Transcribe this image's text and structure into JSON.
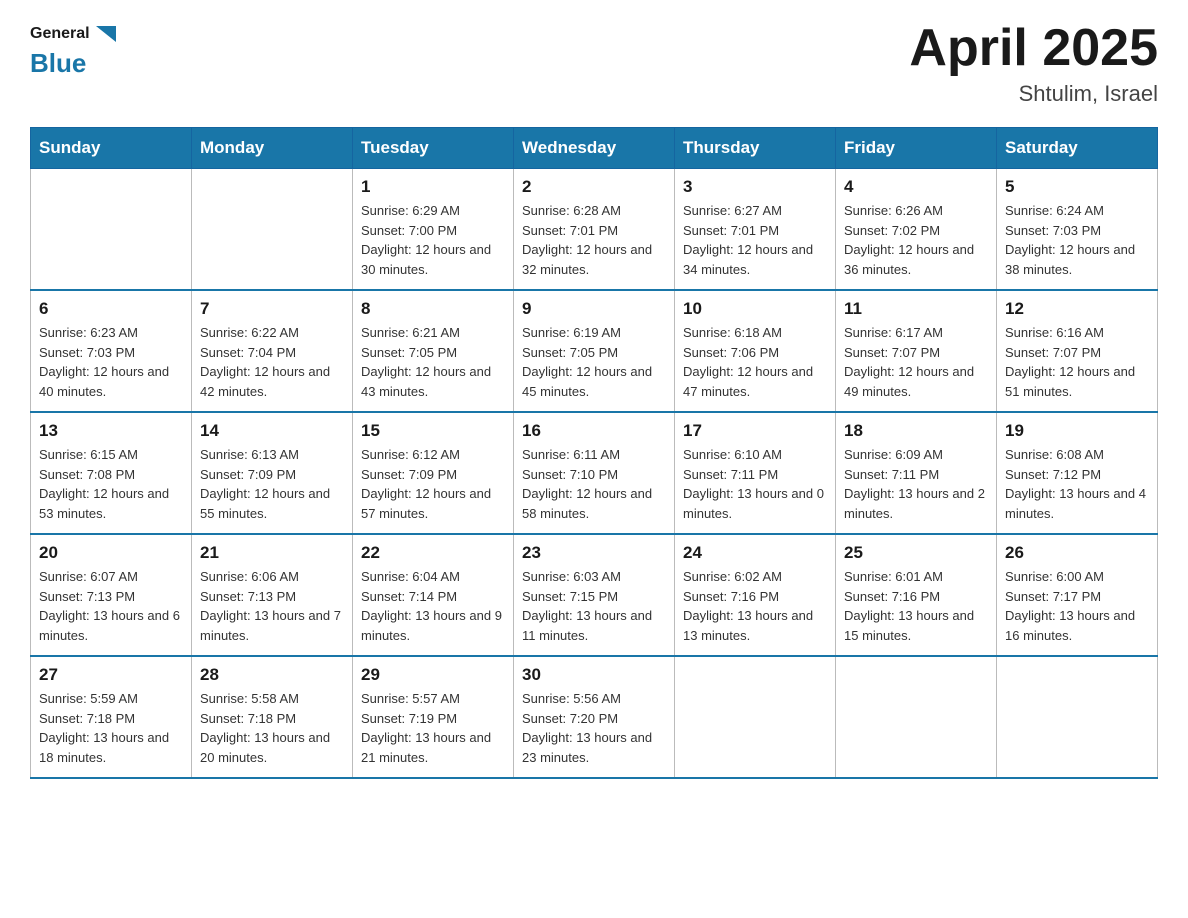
{
  "header": {
    "logo_general": "General",
    "logo_blue": "Blue",
    "month_title": "April 2025",
    "location": "Shtulim, Israel"
  },
  "days_of_week": [
    "Sunday",
    "Monday",
    "Tuesday",
    "Wednesday",
    "Thursday",
    "Friday",
    "Saturday"
  ],
  "weeks": [
    [
      {
        "day": "",
        "sunrise": "",
        "sunset": "",
        "daylight": ""
      },
      {
        "day": "",
        "sunrise": "",
        "sunset": "",
        "daylight": ""
      },
      {
        "day": "1",
        "sunrise": "Sunrise: 6:29 AM",
        "sunset": "Sunset: 7:00 PM",
        "daylight": "Daylight: 12 hours and 30 minutes."
      },
      {
        "day": "2",
        "sunrise": "Sunrise: 6:28 AM",
        "sunset": "Sunset: 7:01 PM",
        "daylight": "Daylight: 12 hours and 32 minutes."
      },
      {
        "day": "3",
        "sunrise": "Sunrise: 6:27 AM",
        "sunset": "Sunset: 7:01 PM",
        "daylight": "Daylight: 12 hours and 34 minutes."
      },
      {
        "day": "4",
        "sunrise": "Sunrise: 6:26 AM",
        "sunset": "Sunset: 7:02 PM",
        "daylight": "Daylight: 12 hours and 36 minutes."
      },
      {
        "day": "5",
        "sunrise": "Sunrise: 6:24 AM",
        "sunset": "Sunset: 7:03 PM",
        "daylight": "Daylight: 12 hours and 38 minutes."
      }
    ],
    [
      {
        "day": "6",
        "sunrise": "Sunrise: 6:23 AM",
        "sunset": "Sunset: 7:03 PM",
        "daylight": "Daylight: 12 hours and 40 minutes."
      },
      {
        "day": "7",
        "sunrise": "Sunrise: 6:22 AM",
        "sunset": "Sunset: 7:04 PM",
        "daylight": "Daylight: 12 hours and 42 minutes."
      },
      {
        "day": "8",
        "sunrise": "Sunrise: 6:21 AM",
        "sunset": "Sunset: 7:05 PM",
        "daylight": "Daylight: 12 hours and 43 minutes."
      },
      {
        "day": "9",
        "sunrise": "Sunrise: 6:19 AM",
        "sunset": "Sunset: 7:05 PM",
        "daylight": "Daylight: 12 hours and 45 minutes."
      },
      {
        "day": "10",
        "sunrise": "Sunrise: 6:18 AM",
        "sunset": "Sunset: 7:06 PM",
        "daylight": "Daylight: 12 hours and 47 minutes."
      },
      {
        "day": "11",
        "sunrise": "Sunrise: 6:17 AM",
        "sunset": "Sunset: 7:07 PM",
        "daylight": "Daylight: 12 hours and 49 minutes."
      },
      {
        "day": "12",
        "sunrise": "Sunrise: 6:16 AM",
        "sunset": "Sunset: 7:07 PM",
        "daylight": "Daylight: 12 hours and 51 minutes."
      }
    ],
    [
      {
        "day": "13",
        "sunrise": "Sunrise: 6:15 AM",
        "sunset": "Sunset: 7:08 PM",
        "daylight": "Daylight: 12 hours and 53 minutes."
      },
      {
        "day": "14",
        "sunrise": "Sunrise: 6:13 AM",
        "sunset": "Sunset: 7:09 PM",
        "daylight": "Daylight: 12 hours and 55 minutes."
      },
      {
        "day": "15",
        "sunrise": "Sunrise: 6:12 AM",
        "sunset": "Sunset: 7:09 PM",
        "daylight": "Daylight: 12 hours and 57 minutes."
      },
      {
        "day": "16",
        "sunrise": "Sunrise: 6:11 AM",
        "sunset": "Sunset: 7:10 PM",
        "daylight": "Daylight: 12 hours and 58 minutes."
      },
      {
        "day": "17",
        "sunrise": "Sunrise: 6:10 AM",
        "sunset": "Sunset: 7:11 PM",
        "daylight": "Daylight: 13 hours and 0 minutes."
      },
      {
        "day": "18",
        "sunrise": "Sunrise: 6:09 AM",
        "sunset": "Sunset: 7:11 PM",
        "daylight": "Daylight: 13 hours and 2 minutes."
      },
      {
        "day": "19",
        "sunrise": "Sunrise: 6:08 AM",
        "sunset": "Sunset: 7:12 PM",
        "daylight": "Daylight: 13 hours and 4 minutes."
      }
    ],
    [
      {
        "day": "20",
        "sunrise": "Sunrise: 6:07 AM",
        "sunset": "Sunset: 7:13 PM",
        "daylight": "Daylight: 13 hours and 6 minutes."
      },
      {
        "day": "21",
        "sunrise": "Sunrise: 6:06 AM",
        "sunset": "Sunset: 7:13 PM",
        "daylight": "Daylight: 13 hours and 7 minutes."
      },
      {
        "day": "22",
        "sunrise": "Sunrise: 6:04 AM",
        "sunset": "Sunset: 7:14 PM",
        "daylight": "Daylight: 13 hours and 9 minutes."
      },
      {
        "day": "23",
        "sunrise": "Sunrise: 6:03 AM",
        "sunset": "Sunset: 7:15 PM",
        "daylight": "Daylight: 13 hours and 11 minutes."
      },
      {
        "day": "24",
        "sunrise": "Sunrise: 6:02 AM",
        "sunset": "Sunset: 7:16 PM",
        "daylight": "Daylight: 13 hours and 13 minutes."
      },
      {
        "day": "25",
        "sunrise": "Sunrise: 6:01 AM",
        "sunset": "Sunset: 7:16 PM",
        "daylight": "Daylight: 13 hours and 15 minutes."
      },
      {
        "day": "26",
        "sunrise": "Sunrise: 6:00 AM",
        "sunset": "Sunset: 7:17 PM",
        "daylight": "Daylight: 13 hours and 16 minutes."
      }
    ],
    [
      {
        "day": "27",
        "sunrise": "Sunrise: 5:59 AM",
        "sunset": "Sunset: 7:18 PM",
        "daylight": "Daylight: 13 hours and 18 minutes."
      },
      {
        "day": "28",
        "sunrise": "Sunrise: 5:58 AM",
        "sunset": "Sunset: 7:18 PM",
        "daylight": "Daylight: 13 hours and 20 minutes."
      },
      {
        "day": "29",
        "sunrise": "Sunrise: 5:57 AM",
        "sunset": "Sunset: 7:19 PM",
        "daylight": "Daylight: 13 hours and 21 minutes."
      },
      {
        "day": "30",
        "sunrise": "Sunrise: 5:56 AM",
        "sunset": "Sunset: 7:20 PM",
        "daylight": "Daylight: 13 hours and 23 minutes."
      },
      {
        "day": "",
        "sunrise": "",
        "sunset": "",
        "daylight": ""
      },
      {
        "day": "",
        "sunrise": "",
        "sunset": "",
        "daylight": ""
      },
      {
        "day": "",
        "sunrise": "",
        "sunset": "",
        "daylight": ""
      }
    ]
  ]
}
